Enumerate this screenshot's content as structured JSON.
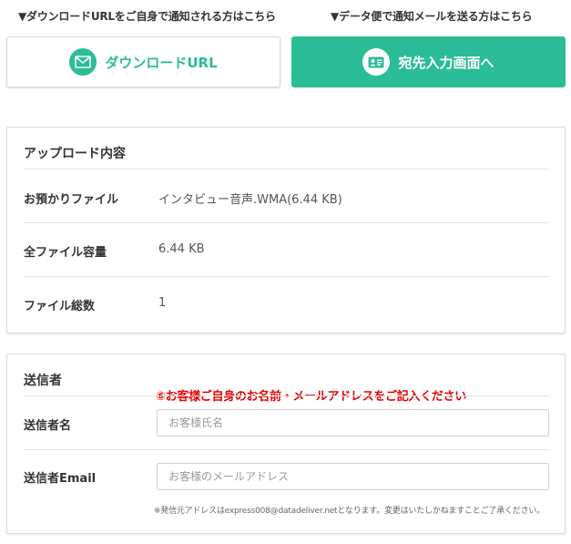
{
  "hints": {
    "download_url": "▼ダウンロードURLをご自身で通知される方はこちら",
    "data_mail": "▼データ便で通知メールを送る方はこちら"
  },
  "buttons": {
    "download_url_label": "ダウンロードURL",
    "download_url_icon": "mail-icon",
    "recipient_label": "宛先入力画面へ",
    "recipient_icon": "address-card-icon"
  },
  "upload": {
    "title": "アップロード内容",
    "rows": [
      {
        "label": "お預かりファイル",
        "value": "インタビュー音声.WMA(6.44 KB)"
      },
      {
        "label": "全ファイル容量",
        "value": "6.44 KB"
      },
      {
        "label": "ファイル総数",
        "value": "1"
      }
    ]
  },
  "sender": {
    "title": "送信者",
    "notice": "⑥お客様ご自身のお名前・メールアドレスをご記入ください",
    "name_label": "送信者名",
    "name_placeholder": "お客様氏名",
    "name_value": "",
    "email_label": "送信者Email",
    "email_placeholder": "お客様のメールアドレス",
    "email_value": "",
    "footnote": "※発信元アドレスはexpress008@datadeliver.netとなります。変更はいたしかねますことご了承ください。"
  },
  "colors": {
    "accent": "#2bbd95",
    "notice": "#e60000",
    "border": "#dcdcdc"
  }
}
